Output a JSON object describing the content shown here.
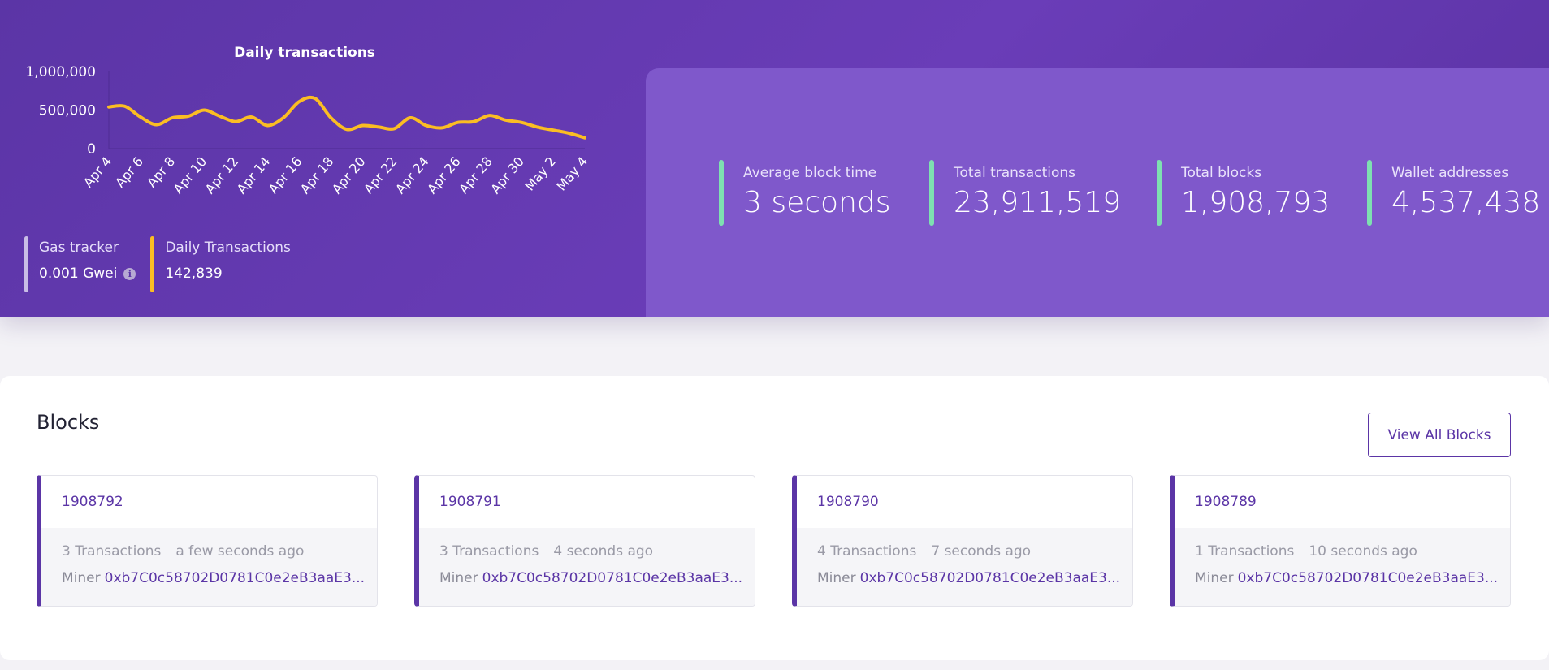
{
  "chart_data": {
    "type": "line",
    "title": "Daily transactions",
    "x": [
      "Apr 4",
      "Apr 5",
      "Apr 6",
      "Apr 7",
      "Apr 8",
      "Apr 9",
      "Apr 10",
      "Apr 11",
      "Apr 12",
      "Apr 13",
      "Apr 14",
      "Apr 15",
      "Apr 16",
      "Apr 17",
      "Apr 18",
      "Apr 19",
      "Apr 20",
      "Apr 21",
      "Apr 22",
      "Apr 23",
      "Apr 24",
      "Apr 25",
      "Apr 26",
      "Apr 27",
      "Apr 28",
      "Apr 29",
      "Apr 30",
      "May 1",
      "May 2",
      "May 3",
      "May 4"
    ],
    "xticks": [
      "Apr 4",
      "Apr 6",
      "Apr 8",
      "Apr 10",
      "Apr 12",
      "Apr 14",
      "Apr 16",
      "Apr 18",
      "Apr 20",
      "Apr 22",
      "Apr 24",
      "Apr 26",
      "Apr 28",
      "Apr 30",
      "May 2",
      "May 4"
    ],
    "series": [
      {
        "values": [
          540000,
          550000,
          410000,
          310000,
          400000,
          420000,
          500000,
          420000,
          350000,
          410000,
          300000,
          400000,
          610000,
          650000,
          400000,
          250000,
          300000,
          280000,
          260000,
          400000,
          300000,
          270000,
          340000,
          350000,
          430000,
          370000,
          340000,
          280000,
          240000,
          200000,
          140000
        ]
      }
    ],
    "yticks": [
      0,
      500000,
      1000000
    ],
    "ytick_labels": [
      "0",
      "500,000",
      "1,000,000"
    ],
    "ylim": [
      0,
      1000000
    ],
    "line_color": "#fbbd23",
    "grid": false
  },
  "mini_stats": [
    {
      "label": "Gas tracker",
      "value": "0.001 Gwei",
      "color": "#c9bde6",
      "icon": "info-icon"
    },
    {
      "label": "Daily Transactions",
      "value": "142,839",
      "color": "#fbbd23"
    }
  ],
  "stats": [
    {
      "label": "Average block time",
      "value": "3 seconds"
    },
    {
      "label": "Total transactions",
      "value": "23,911,519"
    },
    {
      "label": "Total blocks",
      "value": "1,908,793"
    },
    {
      "label": "Wallet addresses",
      "value": "4,537,438"
    }
  ],
  "blocks": {
    "title": "Blocks",
    "view_all_label": "View All Blocks",
    "items": [
      {
        "number": "1908792",
        "transactions": "3 Transactions",
        "age": "a few seconds ago",
        "miner_label": "Miner",
        "miner": "0xb7C0c58702D0781C0e2eB3aaE3..."
      },
      {
        "number": "1908791",
        "transactions": "3 Transactions",
        "age": "4 seconds ago",
        "miner_label": "Miner",
        "miner": "0xb7C0c58702D0781C0e2eB3aaE3..."
      },
      {
        "number": "1908790",
        "transactions": "4 Transactions",
        "age": "7 seconds ago",
        "miner_label": "Miner",
        "miner": "0xb7C0c58702D0781C0e2eB3aaE3..."
      },
      {
        "number": "1908789",
        "transactions": "1 Transactions",
        "age": "10 seconds ago",
        "miner_label": "Miner",
        "miner": "0xb7C0c58702D0781C0e2eB3aaE3..."
      }
    ]
  },
  "colors": {
    "primary": "#5b35a6",
    "stats_panel": "#7f58cb",
    "stat_accent": "#7ee0b1",
    "chart_line": "#fbbd23"
  }
}
